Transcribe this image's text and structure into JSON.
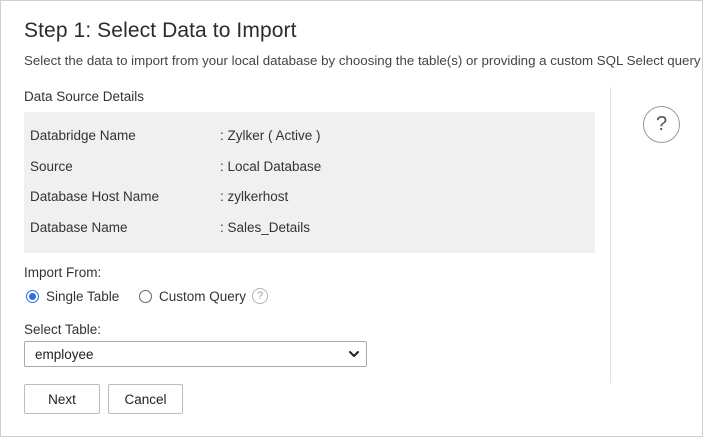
{
  "header": {
    "title": "Step 1: Select Data to Import",
    "subtitle": "Select the data to import from your local database by choosing the table(s) or providing a custom SQL Select query"
  },
  "details": {
    "section_title": "Data Source Details",
    "rows": [
      {
        "label": "Databridge Name",
        "value": ": Zylker ( Active )"
      },
      {
        "label": "Source",
        "value": ": Local Database"
      },
      {
        "label": "Database Host Name",
        "value": ": zylkerhost"
      },
      {
        "label": "Database Name",
        "value": ": Sales_Details"
      }
    ]
  },
  "help": {
    "icon": "question-icon",
    "glyph": "?"
  },
  "import_from": {
    "label": "Import From:",
    "options": [
      {
        "label": "Single Table",
        "selected": true
      },
      {
        "label": "Custom Query",
        "selected": false
      }
    ],
    "info_glyph": "?"
  },
  "table_select": {
    "label": "Select Table:",
    "value": "employee"
  },
  "buttons": {
    "next": "Next",
    "cancel": "Cancel"
  },
  "colors": {
    "accent": "#2f6fd6",
    "panel_bg": "#f0f0f0"
  }
}
